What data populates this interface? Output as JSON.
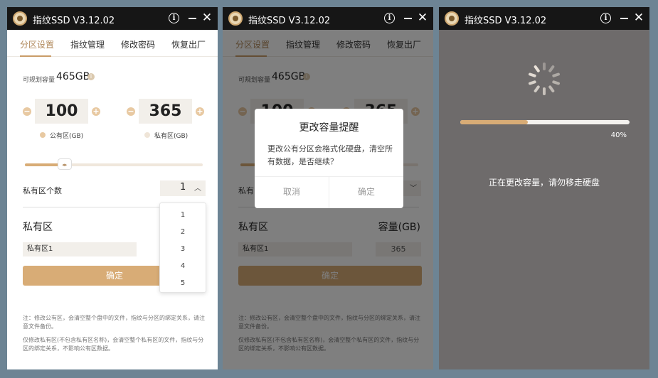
{
  "app": {
    "title": "指纹SSD V3.12.02"
  },
  "tabs": [
    "分区设置",
    "指纹管理",
    "修改密码",
    "恢复出厂"
  ],
  "capacity": {
    "label": "可规划容量",
    "value": "465GB"
  },
  "public": {
    "value": "100",
    "label": "公有区(GB)",
    "color": "#e8c9a2"
  },
  "private": {
    "value": "365",
    "label": "私有区(GB)",
    "color": "#efe5d8"
  },
  "slider": {
    "fill_fraction": 0.215,
    "thumb_glyph": "◂▸"
  },
  "private_count": {
    "label": "私有区个数",
    "value": "1"
  },
  "section": {
    "title": "私有区",
    "capacity_header": "容量(GB)"
  },
  "partition": {
    "name": "私有区1",
    "capacity": "365"
  },
  "confirm_label": "确定",
  "notes": [
    "注：修改公有区，会清空整个盘中的文件，指纹与分区的绑定关系，请注意文件备份。",
    "仅修改私有区(不包含私有区名称)，会清空整个私有区的文件，指纹与分区的绑定关系，不影响公有区数据。"
  ],
  "dropdown_options": [
    "1",
    "2",
    "3",
    "4",
    "5"
  ],
  "dialog": {
    "title": "更改容量提醒",
    "body": "更改公有分区会格式化硬盘，清空所有数据，是否继续？",
    "cancel": "取消",
    "ok": "确定"
  },
  "loading": {
    "progress_percent": 40,
    "progress_text": "40%",
    "message": "正在更改容量，请勿移走硬盘"
  },
  "colors": {
    "accent": "#d8ac76",
    "accent_text": "#b0885a",
    "titlebar": "#161616"
  }
}
